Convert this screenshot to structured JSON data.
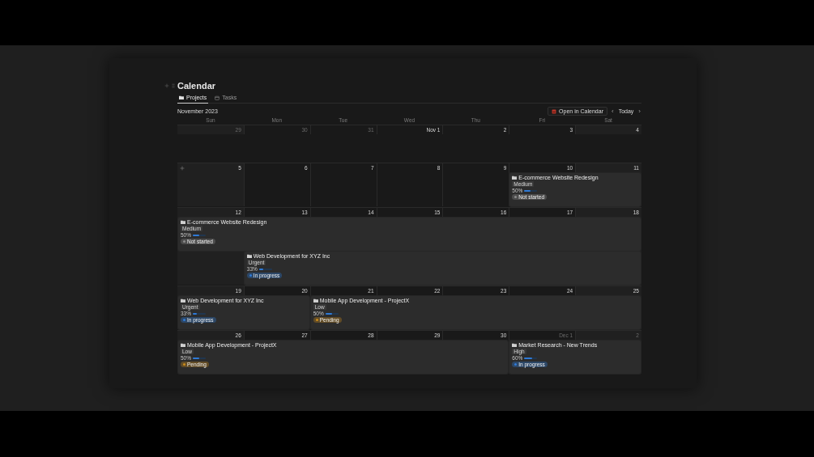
{
  "page": {
    "title": "Calendar"
  },
  "tabs": [
    {
      "label": "Projects",
      "selected": true,
      "kind": "folder"
    },
    {
      "label": "Tasks",
      "selected": false,
      "kind": "calendar"
    }
  ],
  "toolbar": {
    "month": "November 2023",
    "open_button": "Open in Calendar",
    "prev": "‹",
    "today": "Today",
    "next": "›"
  },
  "weekdays": [
    "Sun",
    "Mon",
    "Tue",
    "Wed",
    "Thu",
    "Fri",
    "Sat"
  ],
  "weeks": [
    {
      "days": [
        {
          "label": "29",
          "muted": true,
          "hovered": false
        },
        {
          "label": "30",
          "muted": true,
          "hovered": false
        },
        {
          "label": "31",
          "muted": true,
          "hovered": false
        },
        {
          "label": "Nov 1",
          "muted": false,
          "hovered": false
        },
        {
          "label": "2",
          "muted": false,
          "hovered": false
        },
        {
          "label": "3",
          "muted": false,
          "hovered": false
        },
        {
          "label": "4",
          "muted": false,
          "hovered": false
        }
      ]
    },
    {
      "days": [
        {
          "label": "5",
          "muted": false,
          "hovered": true
        },
        {
          "label": "6",
          "muted": false,
          "hovered": false
        },
        {
          "label": "7",
          "muted": false,
          "hovered": false
        },
        {
          "label": "8",
          "muted": false,
          "hovered": false
        },
        {
          "label": "9",
          "muted": false,
          "hovered": false
        },
        {
          "label": "10",
          "muted": false,
          "hovered": false
        },
        {
          "label": "11",
          "muted": false,
          "hovered": false
        }
      ],
      "events": [
        {
          "title": "E-commerce Website Redesign",
          "priority": "Medium",
          "progress": "50%",
          "level": 0.5,
          "status": "Not started",
          "color": "#8a8a8a"
        }
      ]
    },
    {
      "days": [
        {
          "label": "12",
          "muted": false,
          "hovered": false
        },
        {
          "label": "13",
          "muted": false,
          "hovered": false
        },
        {
          "label": "14",
          "muted": false,
          "hovered": false
        },
        {
          "label": "15",
          "muted": false,
          "hovered": false
        },
        {
          "label": "16",
          "muted": false,
          "hovered": false
        },
        {
          "label": "17",
          "muted": false,
          "hovered": false
        },
        {
          "label": "18",
          "muted": false,
          "hovered": false
        }
      ],
      "events": [
        {
          "title": "E-commerce Website Redesign",
          "priority": "Medium",
          "progress": "50%",
          "level": 0.5,
          "status": "Not started",
          "color": "#8a8a8a"
        },
        {
          "title": "Web Development for XYZ Inc",
          "priority": "Urgent",
          "progress": "33%",
          "level": 0.33,
          "status": "In progress",
          "color": "#2f7ad6"
        }
      ]
    },
    {
      "days": [
        {
          "label": "19",
          "muted": false,
          "hovered": false
        },
        {
          "label": "20",
          "muted": false,
          "hovered": false
        },
        {
          "label": "21",
          "muted": false,
          "hovered": false
        },
        {
          "label": "22",
          "muted": false,
          "hovered": false
        },
        {
          "label": "23",
          "muted": false,
          "hovered": false
        },
        {
          "label": "24",
          "muted": false,
          "hovered": false
        },
        {
          "label": "25",
          "muted": false,
          "hovered": false
        }
      ],
      "events": [
        {
          "title": "Web Development for XYZ Inc",
          "priority": "Urgent",
          "progress": "33%",
          "level": 0.33,
          "status": "In progress",
          "color": "#2f7ad6"
        },
        {
          "title": "Mobile App Development - ProjectX",
          "priority": "Low",
          "progress": "50%",
          "level": 0.5,
          "status": "Pending",
          "color": "#c98a1c"
        }
      ]
    },
    {
      "days": [
        {
          "label": "26",
          "muted": false,
          "hovered": false
        },
        {
          "label": "27",
          "muted": false,
          "hovered": false
        },
        {
          "label": "28",
          "muted": false,
          "hovered": false
        },
        {
          "label": "29",
          "muted": false,
          "hovered": false
        },
        {
          "label": "30",
          "muted": false,
          "hovered": false
        },
        {
          "label": "Dec 1",
          "muted": true,
          "hovered": false
        },
        {
          "label": "2",
          "muted": true,
          "hovered": false
        }
      ],
      "events": [
        {
          "title": "Mobile App Development - ProjectX",
          "priority": "Low",
          "progress": "50%",
          "level": 0.5,
          "status": "Pending",
          "color": "#c98a1c"
        },
        {
          "title": "Market Research - New Trends",
          "priority": "High",
          "progress": "60%",
          "level": 0.6,
          "status": "In progress",
          "color": "#2f7ad6"
        }
      ]
    }
  ]
}
